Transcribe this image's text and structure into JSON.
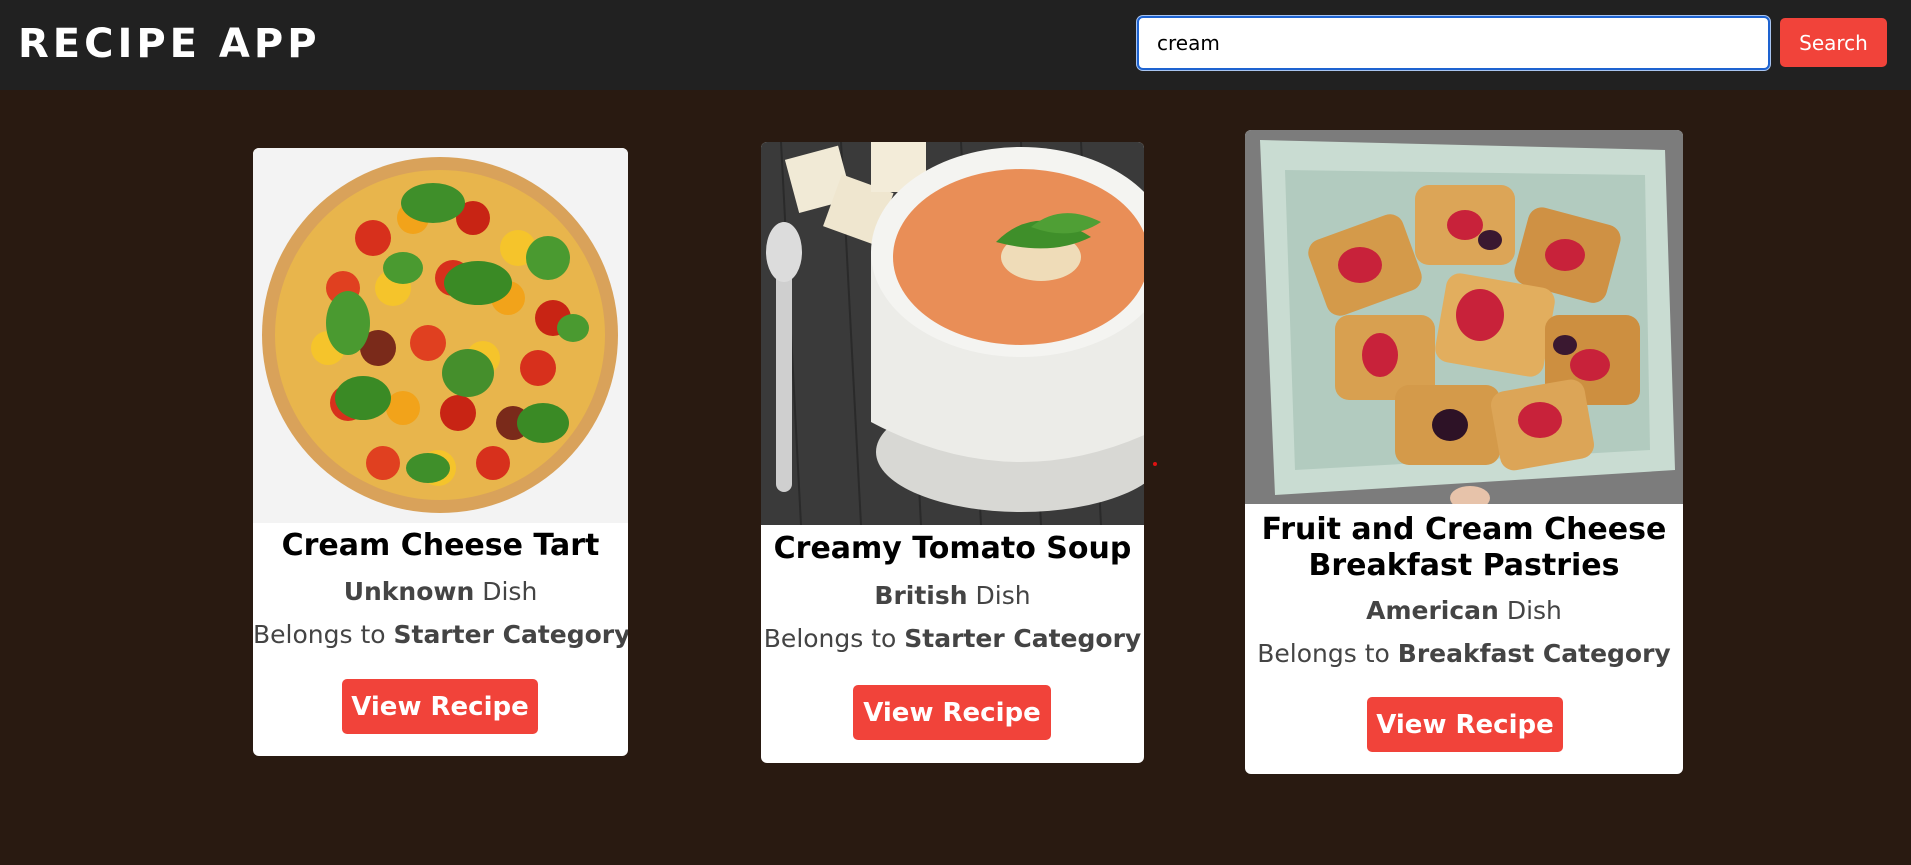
{
  "app": {
    "title": "RECIPE APP"
  },
  "search": {
    "value": "cream",
    "button_label": "Search"
  },
  "recipes": [
    {
      "title": "Cream Cheese Tart",
      "area": "Unknown",
      "area_suffix": "Dish",
      "category_prefix": "Belongs to",
      "category": "Starter Category",
      "button_label": "View Recipe"
    },
    {
      "title": "Creamy Tomato Soup",
      "area": "British",
      "area_suffix": "Dish",
      "category_prefix": "Belongs to",
      "category": "Starter Category",
      "button_label": "View Recipe"
    },
    {
      "title_line1": "Fruit and Cream Cheese",
      "title_line2": "Breakfast Pastries",
      "area": "American",
      "area_suffix": "Dish",
      "category_prefix": "Belongs to",
      "category": "Breakfast Category",
      "button_label": "View Recipe"
    }
  ],
  "colors": {
    "background": "#291a11",
    "navbar": "#212121",
    "accent": "#f1433a",
    "card": "#ffffff"
  }
}
